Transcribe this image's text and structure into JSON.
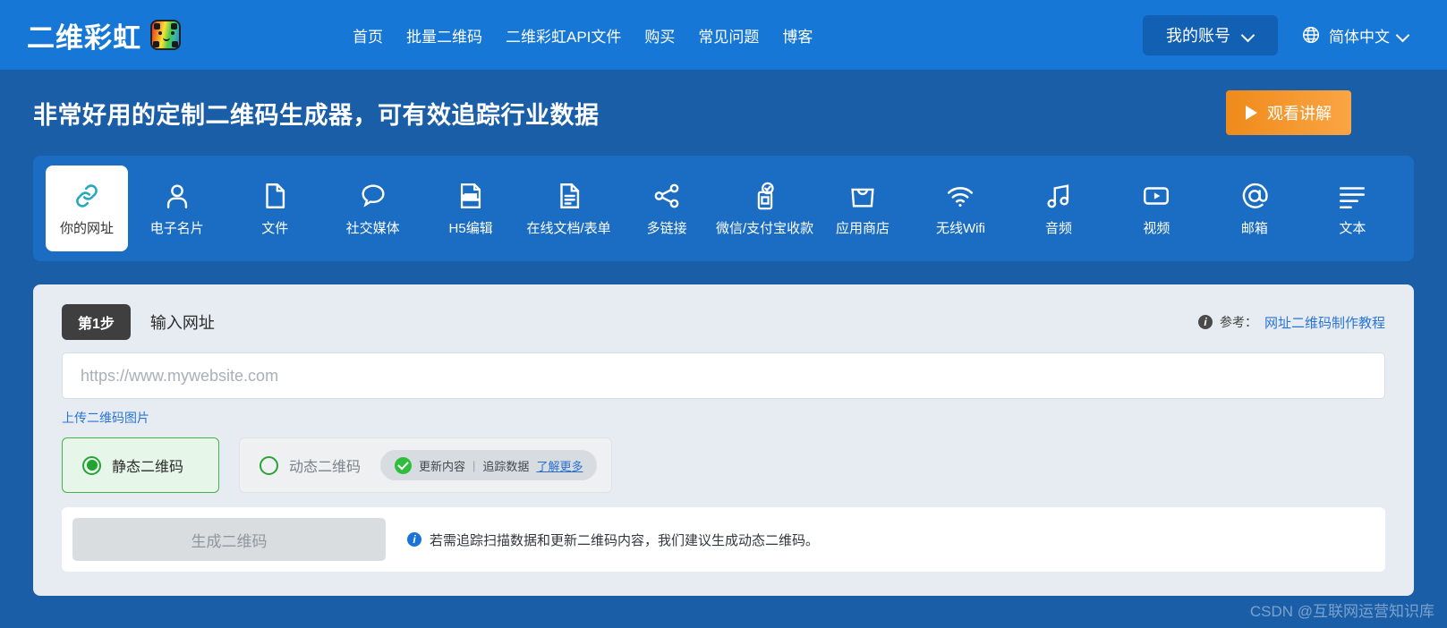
{
  "header": {
    "logo_text": "二维彩虹",
    "logo_icon": "rainbow-bear-icon",
    "nav": [
      {
        "label": "首页"
      },
      {
        "label": "批量二维码"
      },
      {
        "label": "二维彩虹API文件"
      },
      {
        "label": "购买"
      },
      {
        "label": "常见问题"
      },
      {
        "label": "博客"
      }
    ],
    "account_label": "我的账号",
    "language_label": "简体中文",
    "globe_icon": "globe-icon"
  },
  "hero": {
    "headline": "非常好用的定制二维码生成器，可有效追踪行业数据",
    "watch_label": "观看讲解"
  },
  "tabs": [
    {
      "label": "你的网址",
      "icon": "link-icon",
      "active": true
    },
    {
      "label": "电子名片",
      "icon": "person-icon",
      "active": false
    },
    {
      "label": "文件",
      "icon": "file-icon",
      "active": false
    },
    {
      "label": "社交媒体",
      "icon": "chat-bubble-icon",
      "active": false
    },
    {
      "label": "H5编辑",
      "icon": "html-file-icon",
      "active": false
    },
    {
      "label": "在线文档/表单",
      "icon": "document-lines-icon",
      "active": false
    },
    {
      "label": "多链接",
      "icon": "share-nodes-icon",
      "active": false
    },
    {
      "label": "微信/支付宝收款",
      "icon": "mobile-pay-icon",
      "active": false
    },
    {
      "label": "应用商店",
      "icon": "shopping-bag-icon",
      "active": false
    },
    {
      "label": "无线Wifi",
      "icon": "wifi-icon",
      "active": false
    },
    {
      "label": "音频",
      "icon": "music-note-icon",
      "active": false
    },
    {
      "label": "视频",
      "icon": "video-play-icon",
      "active": false
    },
    {
      "label": "邮箱",
      "icon": "at-sign-icon",
      "active": false
    },
    {
      "label": "文本",
      "icon": "text-lines-icon",
      "active": false
    }
  ],
  "step": {
    "badge": "第1步",
    "title": "输入网址",
    "reference_label": "参考：",
    "reference_link": "网址二维码制作教程",
    "url_placeholder": "https://www.mywebsite.com",
    "url_value": "",
    "upload_link": "上传二维码图片",
    "radio_static": "静态二维码",
    "radio_dynamic": "动态二维码",
    "pill_update": "更新内容",
    "pill_divider": "|",
    "pill_track": "追踪数据",
    "pill_link": "了解更多",
    "generate_label": "生成二维码",
    "generate_note": "若需追踪扫描数据和更新二维码内容，我们建议生成动态二维码。"
  },
  "watermark": "CSDN @互联网运营知识库",
  "colors": {
    "header_blue": "#1677d6",
    "hero_blue": "#1b5ea8",
    "tabstrip_blue": "#1a6dc2",
    "accent_orange": "#ef8a1b",
    "link_blue": "#2a74d4",
    "green": "#23a32f",
    "card_gray": "#e6ecf1"
  }
}
